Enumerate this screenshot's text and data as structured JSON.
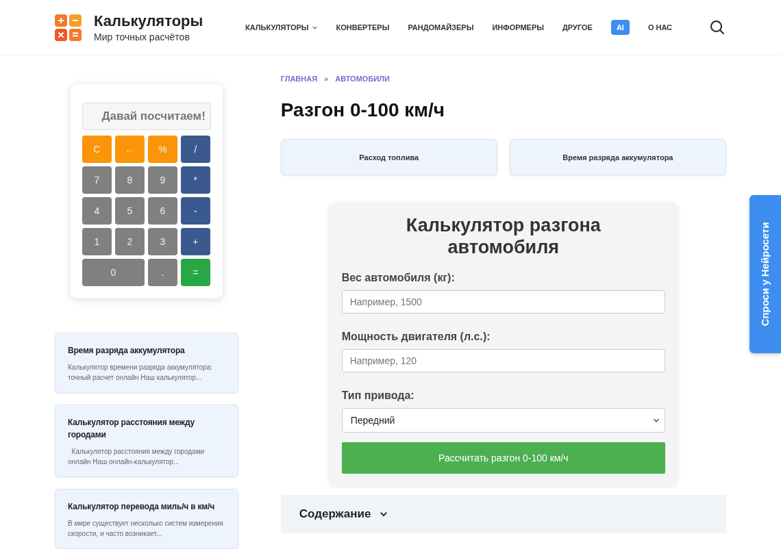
{
  "header": {
    "logo_title": "Калькуляторы",
    "logo_subtitle": "Мир точных расчётов",
    "nav": [
      {
        "label": "КАЛЬКУЛЯТОРЫ",
        "kind": "dropdown"
      },
      {
        "label": "КОНВЕРТЕРЫ",
        "kind": "link"
      },
      {
        "label": "РАНДОМАЙЗЕРЫ",
        "kind": "link"
      },
      {
        "label": "ИНФОРМЕРЫ",
        "kind": "link"
      },
      {
        "label": "ДРУГОЕ",
        "kind": "link"
      },
      {
        "label": "AI",
        "kind": "badge"
      },
      {
        "label": "О НАС",
        "kind": "link"
      }
    ]
  },
  "mini_calculator": {
    "display_placeholder": "Давай посчитаем!",
    "keys": [
      {
        "label": "C",
        "kind": "func"
      },
      {
        "label": "←",
        "kind": "func"
      },
      {
        "label": "%",
        "kind": "func"
      },
      {
        "label": "/",
        "kind": "op"
      },
      {
        "label": "7",
        "kind": "num"
      },
      {
        "label": "8",
        "kind": "num"
      },
      {
        "label": "9",
        "kind": "num"
      },
      {
        "label": "*",
        "kind": "op"
      },
      {
        "label": "4",
        "kind": "num"
      },
      {
        "label": "5",
        "kind": "num"
      },
      {
        "label": "6",
        "kind": "num"
      },
      {
        "label": "-",
        "kind": "op"
      },
      {
        "label": "1",
        "kind": "num"
      },
      {
        "label": "2",
        "kind": "num"
      },
      {
        "label": "3",
        "kind": "num"
      },
      {
        "label": "+",
        "kind": "op"
      },
      {
        "label": "0",
        "kind": "wide"
      },
      {
        "label": ".",
        "kind": "num"
      },
      {
        "label": "=",
        "kind": "equals"
      }
    ]
  },
  "sidebar_cards": [
    {
      "title": "Время разряда аккумулятора",
      "excerpt": "Калькулятор времени разряда аккумулятора: точный расчет онлайн Наш калькулятор..."
    },
    {
      "title": "Калькулятор расстояния между городами",
      "excerpt": "  Калькулятор расстояния между городами онлайн Наш онлайн-калькулятор..."
    },
    {
      "title": "Калькулятор перевода миль/ч в км/ч",
      "excerpt": "В мире существует несколько систем измерения скорости, и часто возникает..."
    }
  ],
  "breadcrumbs": [
    "ГЛАВНАЯ",
    "АВТОМОБИЛИ"
  ],
  "breadcrumb_separator": "»",
  "page_title": "Разгон 0-100 км/ч",
  "related_links": [
    "Расход топлива",
    "Время разряда аккумулятора"
  ],
  "calculator": {
    "title": "Калькулятор разгона автомобиля",
    "fields": [
      {
        "label": "Вес автомобиля (кг):",
        "kind": "input",
        "placeholder": "Например, 1500"
      },
      {
        "label": "Мощность двигателя (л.с.):",
        "kind": "input",
        "placeholder": "Например, 120"
      },
      {
        "label": "Тип привода:",
        "kind": "select",
        "value": "Передний"
      }
    ],
    "submit": "Рассчитать разгон 0-100 км/ч"
  },
  "toc": {
    "title": "Содержание",
    "expanded": false
  },
  "ai_tab": "Спроси у Нейросети"
}
